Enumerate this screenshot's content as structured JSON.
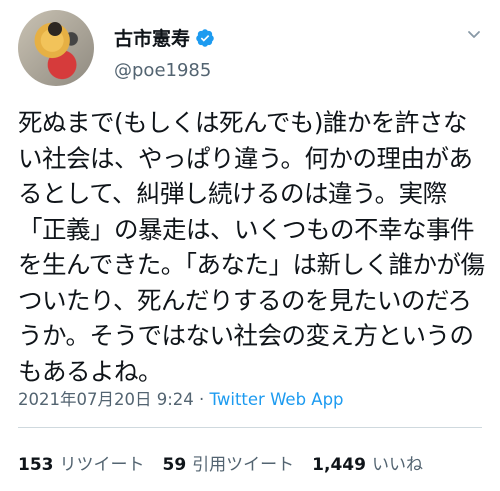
{
  "user": {
    "display_name": "古市憲寿",
    "handle": "@poe1985",
    "verified": true
  },
  "tweet": {
    "text": "死ぬまで(もしくは死んでも)誰かを許さない社会は、やっぱり違う。何かの理由があるとして、糾弾し続けるのは違う。実際「正義」の暴走は、いくつもの不幸な事件を生んできた。「あなた」は新しく誰かが傷ついたり、死んだりするのを見たいのだろうか。そうではない社会の変え方というのもあるよね。",
    "timestamp": "2021年07月20日 9:24",
    "separator": " · ",
    "source": "Twitter Web App"
  },
  "stats": {
    "retweets_count": "153",
    "retweets_label": "リツイート",
    "quotes_count": "59",
    "quotes_label": "引用ツイート",
    "likes_count": "1,449",
    "likes_label": "いいね"
  },
  "colors": {
    "verified_blue": "#1d9bf0",
    "secondary_text": "#536471",
    "primary_text": "#0f1419"
  },
  "icons": {
    "verified": "verified-badge-icon",
    "more": "more-icon"
  }
}
